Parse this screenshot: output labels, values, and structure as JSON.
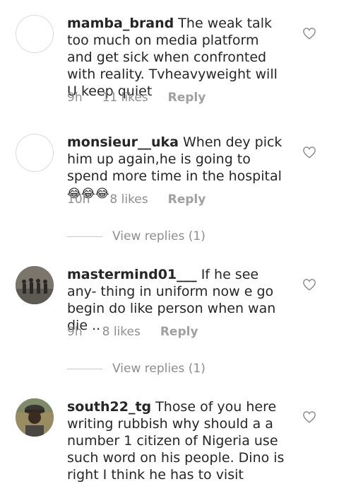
{
  "comments": [
    {
      "username": "mamba_brand",
      "text": " The weak talk too much on media platform and get sick when confronted with reality. Tvheavyweight will U keep quiet",
      "time": "9h",
      "likes": "11 likes",
      "reply": "Reply",
      "avatar": "empty-avatar"
    },
    {
      "username": "monsieur__uka",
      "text": " When dey pick him up again,he is going to spend more time in the hospital",
      "emoji": "😂😂😂",
      "time": "10h",
      "likes": "8 likes",
      "reply": "Reply",
      "avatar": "empty-avatar",
      "view_replies": "View replies (1)"
    },
    {
      "username": "mastermind01___",
      "text": " If he see any- thing in uniform now e go begin do like person when wan die ..",
      "time": "9h",
      "likes": "8 likes",
      "reply": "Reply",
      "avatar": "group-photo-avatar",
      "view_replies": "View replies (1)"
    },
    {
      "username": "south22_tg",
      "text": " Those of you here writing rubbish why should a a number 1 citizen of Nigeria use such word on his people. Dino is right I think he has to visit",
      "avatar": "man-with-cap-avatar"
    }
  ],
  "colors": {
    "text": "#262626",
    "meta": "#8e8e8e",
    "heart_stroke": "#8e8e8e",
    "avatar_border": "#dbdbdb"
  }
}
